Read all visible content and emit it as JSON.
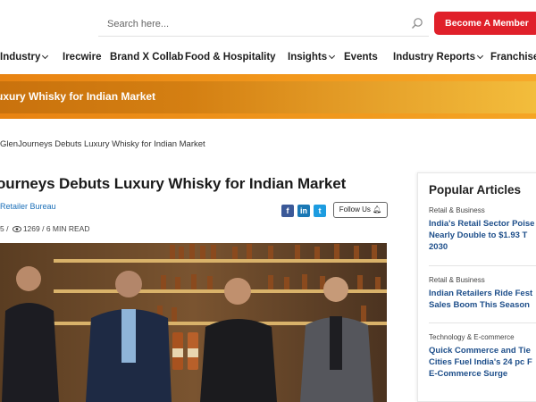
{
  "search": {
    "placeholder": "Search here..."
  },
  "header": {
    "member_button": "Become A Member"
  },
  "nav": {
    "items": [
      {
        "label": "Industry",
        "dropdown": true
      },
      {
        "label": "Irecwire",
        "dropdown": false
      },
      {
        "label": "Brand X Collab",
        "dropdown": false
      },
      {
        "label": "Food & Hospitality",
        "dropdown": false
      },
      {
        "label": "Insights",
        "dropdown": true
      },
      {
        "label": "Events",
        "dropdown": false
      },
      {
        "label": "Industry Reports",
        "dropdown": true
      },
      {
        "label": "FranchiseT",
        "dropdown": false
      }
    ]
  },
  "banner": {
    "title": "uxury Whisky for Indian Market"
  },
  "breadcrumb": "GlenJourneys Debuts Luxury Whisky for Indian Market",
  "article": {
    "headline": "ourneys Debuts Luxury Whisky for Indian Market",
    "author": "Retailer Bureau",
    "meta_prefix": "5 /",
    "views": "1269",
    "read_time": "/ 6 MIN READ",
    "follow_label": "Follow Us"
  },
  "sidebar": {
    "title": "Popular Articles",
    "articles": [
      {
        "category": "Retail & Business",
        "title_lines": [
          "India's Retail Sector Poise",
          "Nearly Double to $1.93 T",
          "2030"
        ]
      },
      {
        "category": "Retail & Business",
        "title_lines": [
          "Indian Retailers Ride Fest",
          "Sales Boom This Season"
        ]
      },
      {
        "category": "Technology & E-commerce",
        "title_lines": [
          "Quick Commerce and Tie",
          "Cities Fuel India's 24 pc F",
          "E-Commerce Surge"
        ]
      }
    ]
  },
  "colors": {
    "accent_red": "#e0202a",
    "banner_orange": "#d47f12",
    "link_blue": "#1d4e8a"
  },
  "icons": {
    "search": "search-icon",
    "views": "eye-icon",
    "follow": "bell-icon"
  }
}
